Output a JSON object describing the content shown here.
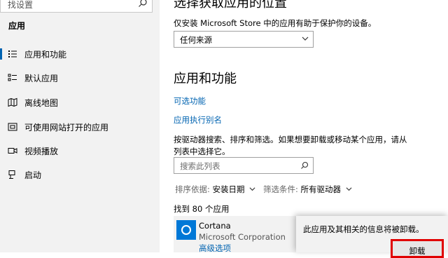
{
  "sidebar": {
    "search_value": "找设置",
    "section_title": "应用",
    "items": [
      {
        "label": "应用和功能",
        "icon": "apps-features-icon"
      },
      {
        "label": "默认应用",
        "icon": "default-apps-icon"
      },
      {
        "label": "离线地图",
        "icon": "offline-maps-icon"
      },
      {
        "label": "可使用网站打开的应用",
        "icon": "apps-for-websites-icon"
      },
      {
        "label": "视频播放",
        "icon": "video-playback-icon"
      },
      {
        "label": "启动",
        "icon": "startup-icon"
      }
    ]
  },
  "main": {
    "install_heading": "选择获取应用的位置",
    "install_desc": "仅安装 Microsoft Store 中的应用有助于保护你的设备。",
    "install_dropdown_value": "任何来源",
    "apps_heading": "应用和功能",
    "optional_features_link": "可选功能",
    "app_alias_link": "应用执行别名",
    "search_desc": "按驱动器搜索、排序和筛选。如果想要卸载或移动某个应用，请从列表中选择它。",
    "list_search_placeholder": "搜索此列表",
    "sort_label": "排序依据:",
    "sort_value": "安装日期",
    "filter_label": "筛选条件:",
    "filter_value": "所有驱动器",
    "found_count": "找到 80 个应用",
    "app": {
      "name": "Cortana",
      "publisher": "Microsoft Corporation",
      "advanced_link": "高级选项"
    }
  },
  "popup": {
    "message": "此应用及其相关的信息将被卸载。",
    "uninstall_button": "卸载"
  },
  "colors": {
    "accent": "#0063b1",
    "highlight_border": "#e00000"
  }
}
